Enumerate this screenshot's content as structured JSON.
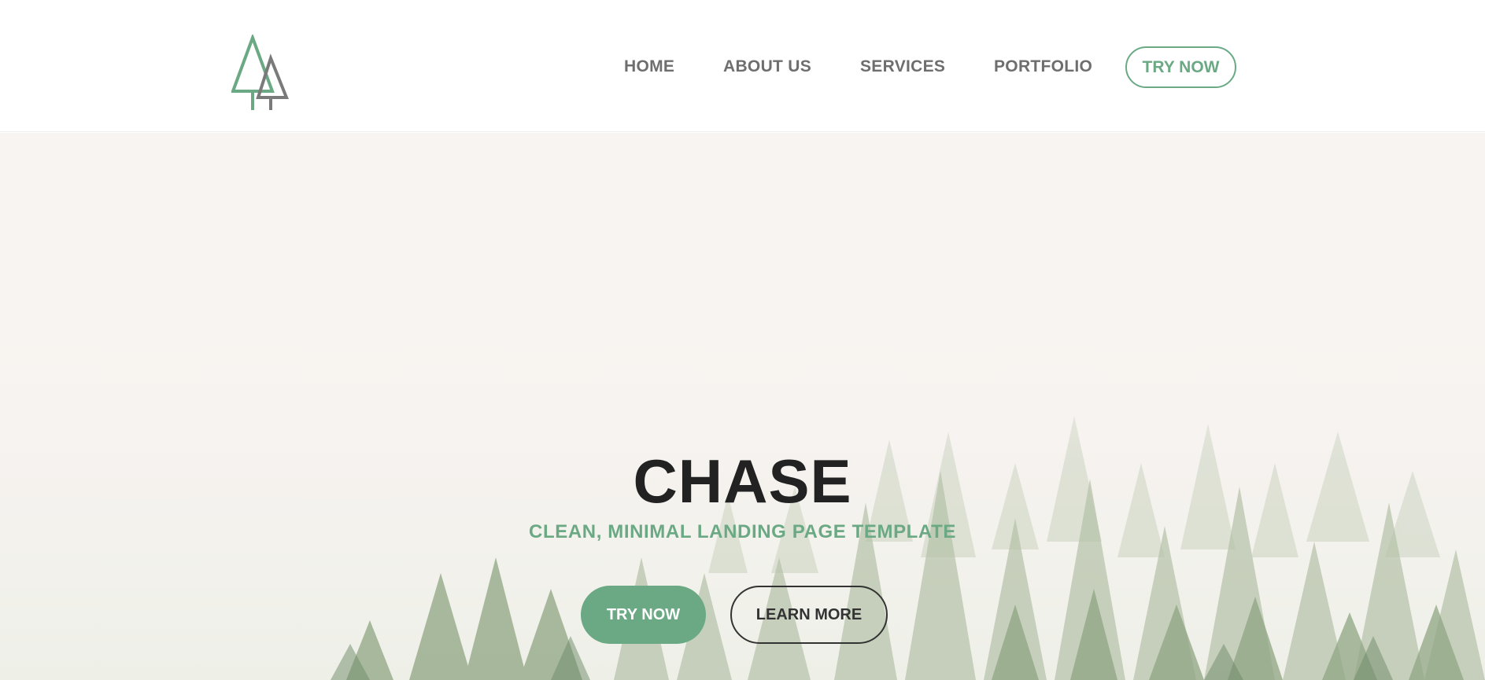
{
  "header": {
    "logo_icon": "pine-trees-icon",
    "nav": {
      "home": "HOME",
      "about": "ABOUT US",
      "services": "SERVICES",
      "portfolio": "PORTFOLIO",
      "try_now": "TRY NOW"
    }
  },
  "hero": {
    "title": "CHASE",
    "subtitle": "CLEAN, MINIMAL LANDING PAGE TEMPLATE",
    "primary_button": "TRY NOW",
    "secondary_button": "LEARN MORE",
    "background_icon": "misty-forest-image"
  },
  "colors": {
    "accent": "#6aa984",
    "nav_text": "#6e6e6e",
    "title": "#222222",
    "hero_bg": "#f8f4f1"
  }
}
